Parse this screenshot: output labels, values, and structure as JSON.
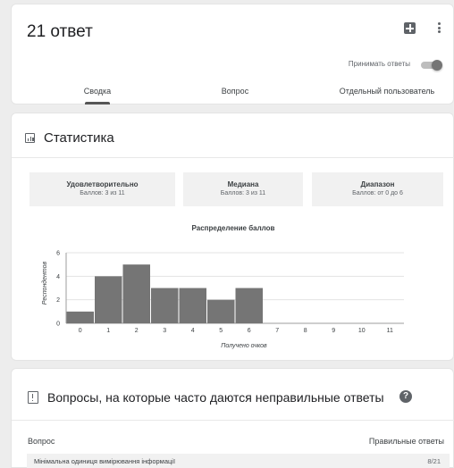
{
  "header": {
    "title": "21 ответ",
    "accept_label": "Принимать ответы",
    "accepting": true,
    "tabs": [
      {
        "label": "Сводка",
        "active": true
      },
      {
        "label": "Вопрос",
        "active": false
      },
      {
        "label": "Отдельный пользователь",
        "active": false
      }
    ]
  },
  "stats": {
    "title": "Статистика",
    "boxes": [
      {
        "title": "Удовлетворительно",
        "sub": "Баллов: 3 из 11"
      },
      {
        "title": "Медиана",
        "sub": "Баллов: 3 из 11"
      },
      {
        "title": "Диапазон",
        "sub": "Баллов: от 0 до 6"
      }
    ]
  },
  "chart_data": {
    "type": "bar",
    "title": "Распределение баллов",
    "xlabel": "Получено очков",
    "ylabel": "Респондентов",
    "categories": [
      "0",
      "1",
      "2",
      "3",
      "4",
      "5",
      "6",
      "7",
      "8",
      "9",
      "10",
      "11"
    ],
    "values": [
      1,
      4,
      5,
      3,
      3,
      2,
      3,
      0,
      0,
      0,
      0,
      0
    ],
    "ylim": [
      0,
      6
    ],
    "yticks": [
      "0",
      "2",
      "4",
      "6"
    ],
    "grid": true,
    "bar_color": "#757575"
  },
  "questions": {
    "title": "Вопросы, на которые часто даются неправильные ответы",
    "col_question": "Вопрос",
    "col_correct": "Правильные ответы",
    "rows": [
      {
        "question": "Мінімальна одиниця вимірювання інформації",
        "correct": "8/21"
      }
    ]
  }
}
